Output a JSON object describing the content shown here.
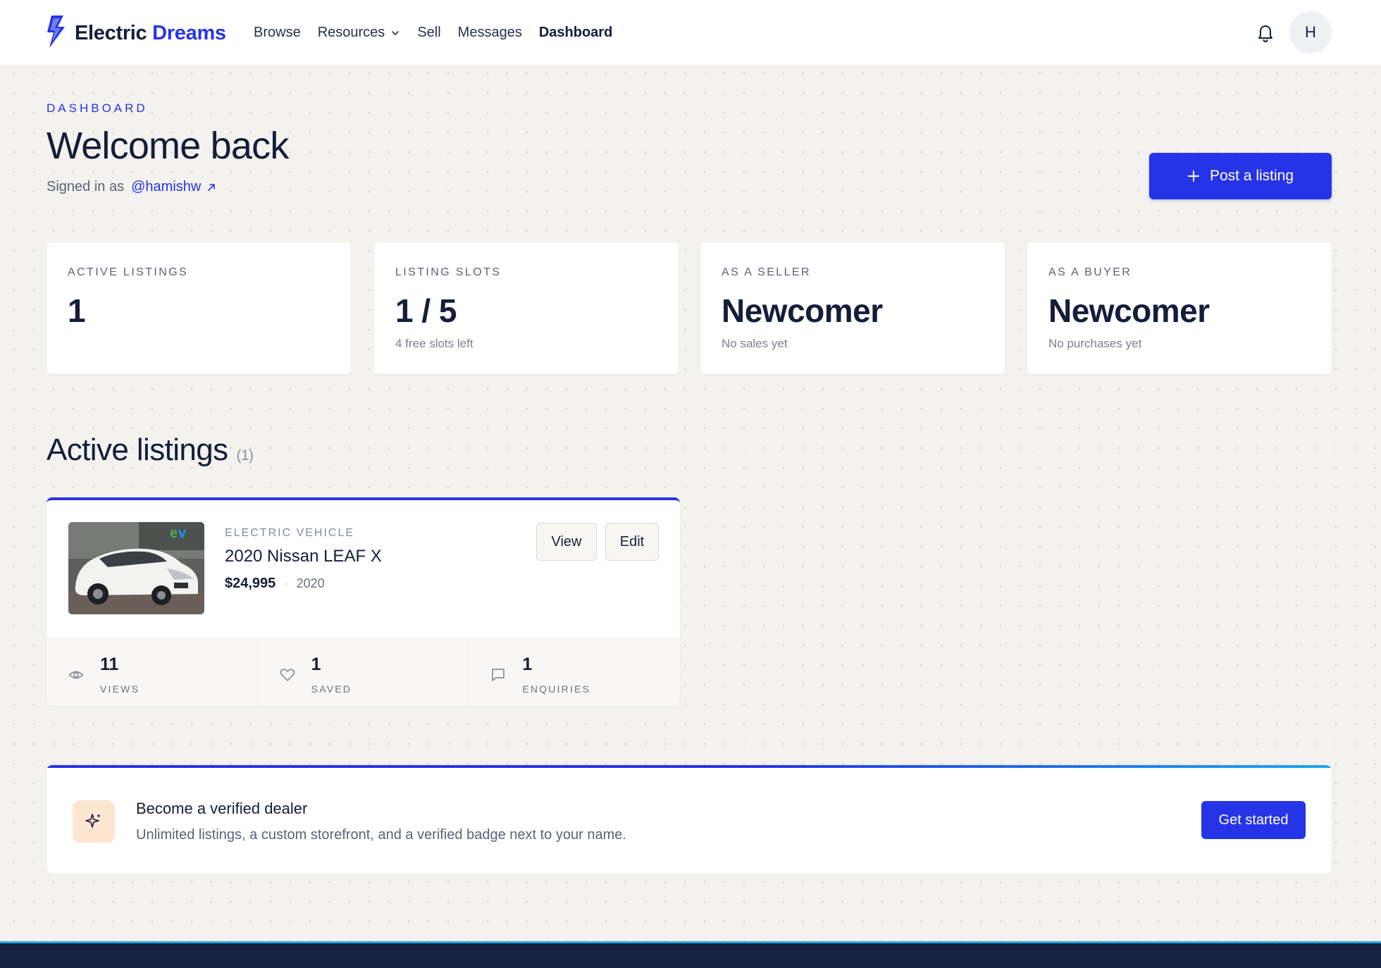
{
  "nav": {
    "brand_part1": "Electric",
    "brand_part2": "Dreams",
    "links": [
      "Browse",
      "Resources",
      "Sell",
      "Messages",
      "Dashboard"
    ],
    "active": "Dashboard",
    "avatar_initial": "H",
    "icons": {
      "logo": "bolt-logo-icon",
      "bell": "bell-icon",
      "dropdown": "chevron-down-icon"
    }
  },
  "header": {
    "eyebrow": "DASHBOARD",
    "title": "Welcome back",
    "signed_in_prefix": "Signed in as",
    "username": "@hamishw",
    "post_button": "Post a listing"
  },
  "stats": [
    {
      "label": "ACTIVE LISTINGS",
      "value": "1",
      "sub": ""
    },
    {
      "label": "LISTING SLOTS",
      "value": "1 / 5",
      "sub": "4 free slots left"
    },
    {
      "label": "AS A SELLER",
      "value": "Newcomer",
      "sub": "No sales yet"
    },
    {
      "label": "AS A BUYER",
      "value": "Newcomer",
      "sub": "No purchases yet"
    }
  ],
  "active_listings": {
    "title": "Active listings",
    "count": "(1)",
    "items": [
      {
        "category": "ELECTRIC VEHICLE",
        "title": "2020 Nissan LEAF X",
        "price": "$24,995",
        "separator": "·",
        "year": "2020",
        "view_button": "View",
        "edit_button": "Edit",
        "stats": [
          {
            "icon": "eye-icon",
            "value": "11",
            "label": "VIEWS"
          },
          {
            "icon": "heart-icon",
            "value": "1",
            "label": "SAVED"
          },
          {
            "icon": "chat-icon",
            "value": "1",
            "label": "ENQUIRIES"
          }
        ]
      }
    ]
  },
  "dealer": {
    "title": "Become a verified dealer",
    "description": "Unlimited listings, a custom storefront, and a verified badge next to your name.",
    "button": "Get started",
    "icon": "sparkle-icon"
  },
  "colors": {
    "accent": "#2634e8",
    "text": "#141d3a",
    "background": "#f3f2ef",
    "footer": "#162241"
  }
}
